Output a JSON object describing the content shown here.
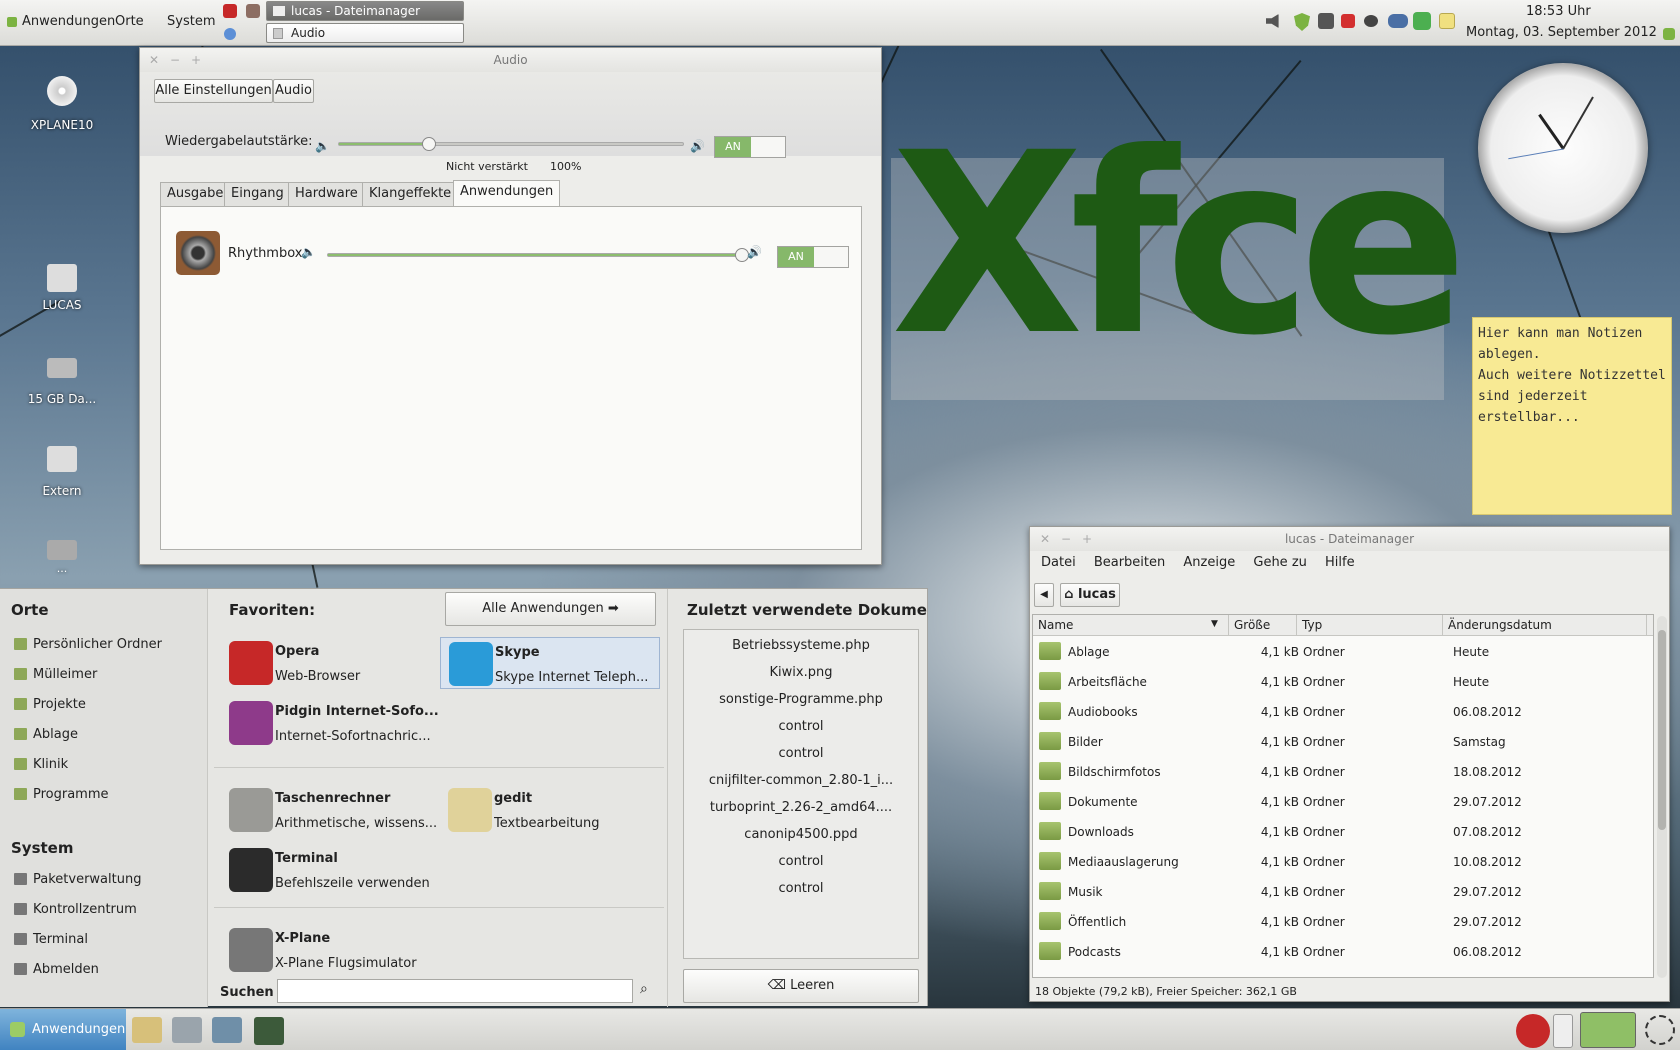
{
  "top_panel": {
    "menus": [
      "Anwendungen",
      "Orte",
      "System"
    ],
    "tasks": [
      {
        "label": "lucas - Dateimanager"
      },
      {
        "label": "Audio"
      }
    ],
    "clock_time": "18:53 Uhr",
    "clock_date": "Montag, 03. September 2012"
  },
  "desktop": {
    "icons": [
      "XPLANE10",
      "LUCAS",
      "15 GB Da...",
      "Extern",
      "..."
    ],
    "xfce_logo": "Xfce",
    "note_lines": [
      "Hier kann man Notizen",
      "ablegen.",
      "Auch weitere Notizzettel",
      "sind jederzeit erstellbar..."
    ]
  },
  "audio": {
    "title": "Audio",
    "breadcrumb": [
      "Alle Einstellungen",
      "Audio"
    ],
    "volume_label": "Wiedergabelautstärke:",
    "volume_level": 0.26,
    "mark_unamplified": "Nicht verstärkt",
    "mark_100": "100%",
    "toggle_on": "AN",
    "tabs": [
      "Ausgabe",
      "Eingang",
      "Hardware",
      "Klangeffekte",
      "Anwendungen"
    ],
    "active_tab": "Anwendungen",
    "app_name": "Rhythmbox",
    "app_level": 1.0
  },
  "menu": {
    "places_header": "Orte",
    "places": [
      "Persönlicher Ordner",
      "Mülleimer",
      "Projekte",
      "Ablage",
      "Klinik",
      "Programme"
    ],
    "system_header": "System",
    "system": [
      "Paketverwaltung",
      "Kontrollzentrum",
      "Terminal",
      "Abmelden"
    ],
    "favorites_header": "Favoriten:",
    "all_apps": "Alle Anwendungen",
    "favorites": [
      {
        "name": "Opera",
        "desc": "Web-Browser"
      },
      {
        "name": "Skype",
        "desc": "Skype Internet Teleph..."
      },
      {
        "name": "Pidgin Internet-Sofo...",
        "desc": "Internet-Sofortnachric..."
      },
      {
        "name": "Taschenrechner",
        "desc": "Arithmetische, wissens..."
      },
      {
        "name": "gedit",
        "desc": "Textbearbeitung"
      },
      {
        "name": "Terminal",
        "desc": "Befehlszeile verwenden"
      },
      {
        "name": "X-Plane",
        "desc": "X-Plane Flugsimulator"
      }
    ],
    "search_label": "Suchen",
    "recent_header": "Zuletzt verwendete Dokumen",
    "recent": [
      "Betriebssysteme.php",
      "Kiwix.png",
      "sonstige-Programme.php",
      "control",
      "control",
      "cnijfilter-common_2.80-1_i...",
      "turboprint_2.26-2_amd64....",
      "canonip4500.ppd",
      "control",
      "control"
    ],
    "clear_label": "Leeren"
  },
  "filemanager": {
    "title": "lucas - Dateimanager",
    "menu": [
      "Datei",
      "Bearbeiten",
      "Anzeige",
      "Gehe zu",
      "Hilfe"
    ],
    "location": "lucas",
    "columns": [
      "Name",
      "Größe",
      "Typ",
      "Änderungsdatum"
    ],
    "rows": [
      {
        "name": "Ablage",
        "size": "4,1 kB",
        "type": "Ordner",
        "date": "Heute"
      },
      {
        "name": "Arbeitsfläche",
        "size": "4,1 kB",
        "type": "Ordner",
        "date": "Heute"
      },
      {
        "name": "Audiobooks",
        "size": "4,1 kB",
        "type": "Ordner",
        "date": "06.08.2012"
      },
      {
        "name": "Bilder",
        "size": "4,1 kB",
        "type": "Ordner",
        "date": "Samstag"
      },
      {
        "name": "Bildschirmfotos",
        "size": "4,1 kB",
        "type": "Ordner",
        "date": "18.08.2012"
      },
      {
        "name": "Dokumente",
        "size": "4,1 kB",
        "type": "Ordner",
        "date": "29.07.2012"
      },
      {
        "name": "Downloads",
        "size": "4,1 kB",
        "type": "Ordner",
        "date": "07.08.2012"
      },
      {
        "name": "Mediaauslagerung",
        "size": "4,1 kB",
        "type": "Ordner",
        "date": "10.08.2012"
      },
      {
        "name": "Musik",
        "size": "4,1 kB",
        "type": "Ordner",
        "date": "29.07.2012"
      },
      {
        "name": "Öffentlich",
        "size": "4,1 kB",
        "type": "Ordner",
        "date": "29.07.2012"
      },
      {
        "name": "Podcasts",
        "size": "4,1 kB",
        "type": "Ordner",
        "date": "06.08.2012"
      }
    ],
    "status": "18 Objekte (79,2 kB), Freier Speicher: 362,1 GB"
  },
  "bottom_panel": {
    "menu_label": "Anwendungen"
  }
}
